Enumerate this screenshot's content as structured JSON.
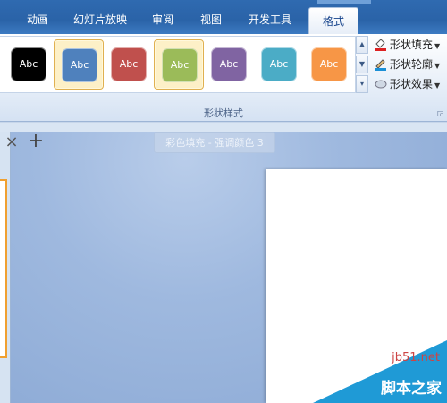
{
  "ribbon": {
    "tabs": [
      {
        "label": "动画",
        "active": false
      },
      {
        "label": "幻灯片放映",
        "active": false
      },
      {
        "label": "审阅",
        "active": false
      },
      {
        "label": "视图",
        "active": false
      },
      {
        "label": "开发工具",
        "active": false
      },
      {
        "label": "格式",
        "active": true
      }
    ],
    "shape_styles": [
      {
        "label": "Abc",
        "color": "#000000",
        "selected": false
      },
      {
        "label": "Abc",
        "color": "#4f81bd",
        "selected": true
      },
      {
        "label": "Abc",
        "color": "#c0504d",
        "selected": false
      },
      {
        "label": "Abc",
        "color": "#9bbb59",
        "selected": true
      },
      {
        "label": "Abc",
        "color": "#8064a2",
        "selected": false
      },
      {
        "label": "Abc",
        "color": "#4bacc6",
        "selected": false
      },
      {
        "label": "Abc",
        "color": "#f79646",
        "selected": false
      }
    ],
    "commands": {
      "shape_fill": "形状填充",
      "shape_outline": "形状轮廓",
      "shape_effects": "形状效果"
    },
    "group_label": "形状样式"
  },
  "editor": {
    "tooltip": "彩色填充 - 强调颜色 3"
  },
  "watermark": {
    "url": "jb51.net",
    "name": "脚本之家"
  }
}
